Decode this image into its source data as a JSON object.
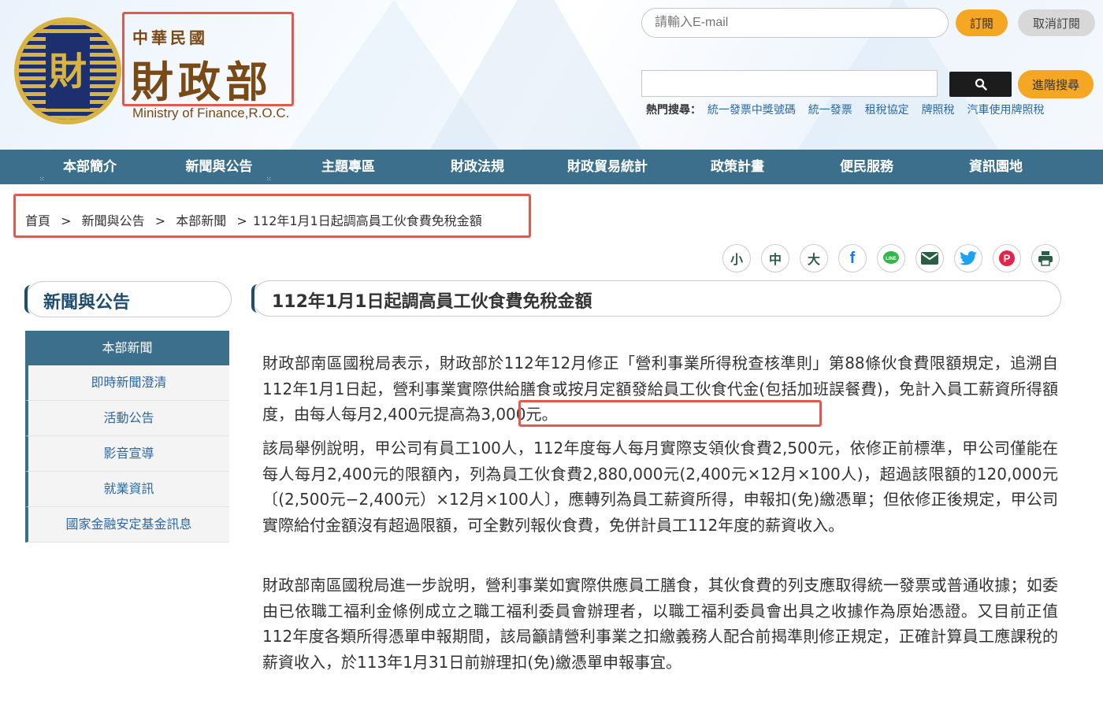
{
  "header": {
    "brand_small": "中華民國",
    "brand_big": "財政部",
    "brand_en": "Ministry of Finance,R.O.C.",
    "logo_glyph": "財",
    "email_placeholder": "請輸入E-mail",
    "subscribe_label": "訂閱",
    "unsubscribe_label": "取消訂閱",
    "search_value": "",
    "advanced_search_label": "進階搜尋",
    "hot_label": "熱門搜尋：",
    "hot_links": [
      "統一發票中獎號碼",
      "統一發票",
      "租稅協定",
      "牌照稅",
      "汽車使用牌照稅"
    ]
  },
  "nav": {
    "items": [
      "本部簡介",
      "新聞與公告",
      "主題專區",
      "財政法規",
      "財政貿易統計",
      "政策計畫",
      "便民服務",
      "資訊園地"
    ]
  },
  "breadcrumb": {
    "items": [
      "首頁",
      "新聞與公告",
      "本部新聞",
      "112年1月1日起調高員工伙食費免稅金額"
    ],
    "separator": ">"
  },
  "tools": {
    "font_small": "小",
    "font_medium": "中",
    "font_large": "大"
  },
  "sidebar": {
    "title": "新聞與公告",
    "head": "本部新聞",
    "items": [
      "即時新聞澄清",
      "活動公告",
      "影音宣導",
      "就業資訊",
      "國家金融安定基金訊息"
    ]
  },
  "article": {
    "title": "112年1月1日起調高員工伙食費免稅金額",
    "paragraphs": [
      "財政部南區國稅局表示，財政部於112年12月修正「營利事業所得稅查核準則」第88條伙食費限額規定，追溯自112年1月1日起，營利事業實際供給膳食或按月定額發給員工伙食代金(包括加班誤餐費)，免計入員工薪資所得額度，由每人每月2,400元提高為3,000元。",
      "該局舉例說明，甲公司有員工100人，112年度每人每月實際支領伙食費2,500元，依修正前標準，甲公司僅能在每人每月2,400元的限額內，列為員工伙食費2,880,000元(2,400元×12月×100人)，超過該限額的120,000元〔(2,500元−2,400元）×12月×100人〕，應轉列為員工薪資所得，申報扣(免)繳憑單；但依修正後規定，甲公司實際給付金額沒有超過限額，可全數列報伙食費，免併計員工112年度的薪資收入。",
      "財政部南區國稅局進一步說明，營利事業如實際供應員工膳食，其伙食費的列支應取得統一發票或普通收據；如委由已依職工福利金條例成立之職工福利委員會辦理者，以職工福利委員會出具之收據作為原始憑證。又目前正值112年度各類所得憑單申報期間，該局籲請營利事業之扣繳義務人配合前揭準則修正規定，正確計算員工應課稅的薪資收入，於113年1月31日前辦理扣(免)繳憑單申報事宜。"
    ]
  },
  "colors": {
    "nav_bg": "#3b6f8c",
    "accent_orange": "#f5a623",
    "highlight_red": "#e05a4e",
    "link_blue": "#2b68a3"
  }
}
